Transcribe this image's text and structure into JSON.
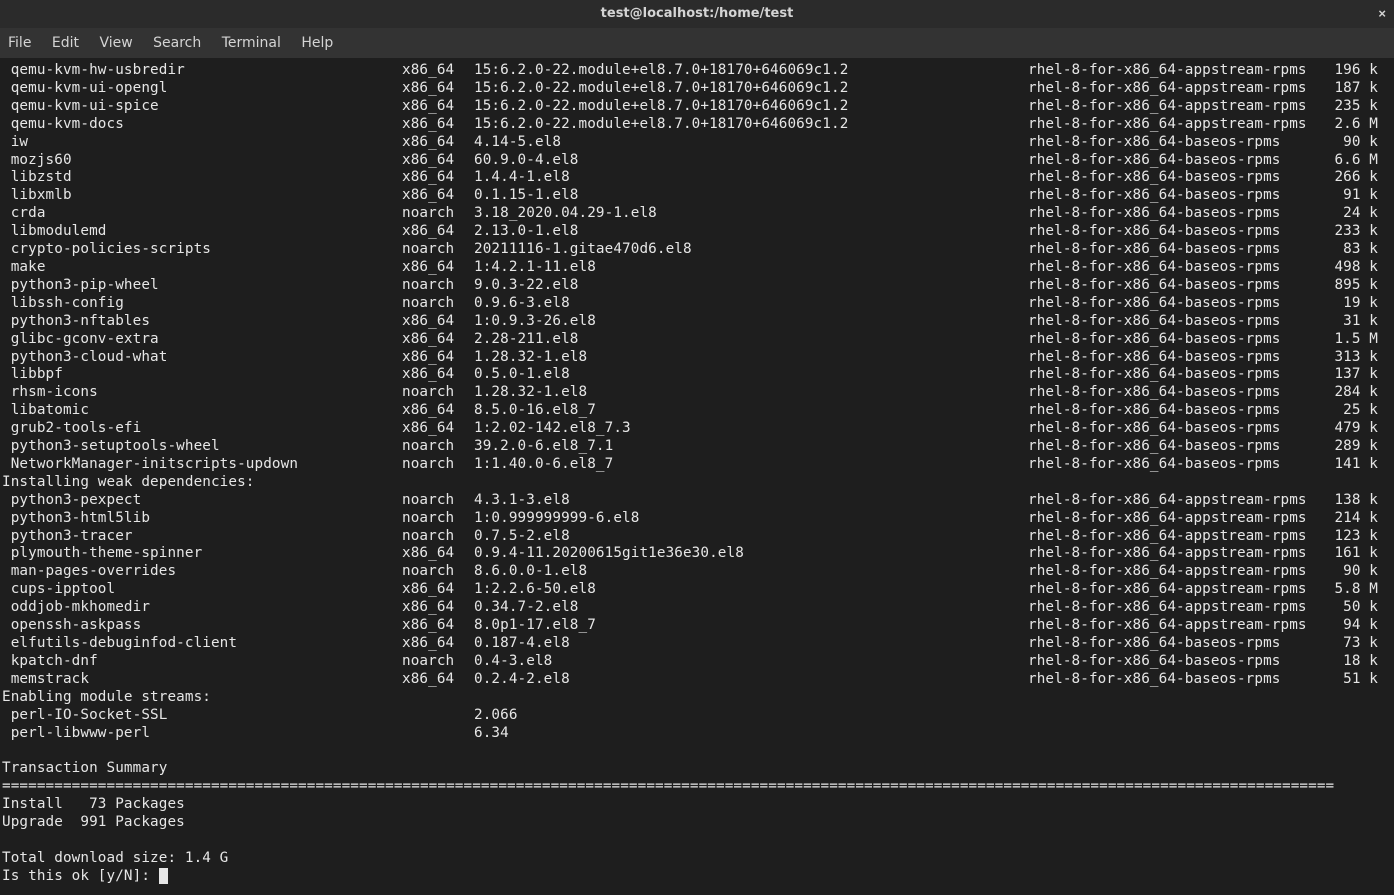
{
  "window": {
    "title": "test@localhost:/home/test"
  },
  "menu": {
    "file": "File",
    "edit": "Edit",
    "view": "View",
    "search": "Search",
    "terminal": "Terminal",
    "help": "Help"
  },
  "packages": [
    {
      "name": " qemu-kvm-hw-usbredir",
      "arch": "x86_64",
      "ver": "15:6.2.0-22.module+el8.7.0+18170+646069c1.2",
      "repo": "rhel-8-for-x86_64-appstream-rpms",
      "size": "196 k"
    },
    {
      "name": " qemu-kvm-ui-opengl",
      "arch": "x86_64",
      "ver": "15:6.2.0-22.module+el8.7.0+18170+646069c1.2",
      "repo": "rhel-8-for-x86_64-appstream-rpms",
      "size": "187 k"
    },
    {
      "name": " qemu-kvm-ui-spice",
      "arch": "x86_64",
      "ver": "15:6.2.0-22.module+el8.7.0+18170+646069c1.2",
      "repo": "rhel-8-for-x86_64-appstream-rpms",
      "size": "235 k"
    },
    {
      "name": " qemu-kvm-docs",
      "arch": "x86_64",
      "ver": "15:6.2.0-22.module+el8.7.0+18170+646069c1.2",
      "repo": "rhel-8-for-x86_64-appstream-rpms",
      "size": "2.6 M"
    },
    {
      "name": " iw",
      "arch": "x86_64",
      "ver": "4.14-5.el8",
      "repo": "rhel-8-for-x86_64-baseos-rpms",
      "size": "90 k"
    },
    {
      "name": " mozjs60",
      "arch": "x86_64",
      "ver": "60.9.0-4.el8",
      "repo": "rhel-8-for-x86_64-baseos-rpms",
      "size": "6.6 M"
    },
    {
      "name": " libzstd",
      "arch": "x86_64",
      "ver": "1.4.4-1.el8",
      "repo": "rhel-8-for-x86_64-baseos-rpms",
      "size": "266 k"
    },
    {
      "name": " libxmlb",
      "arch": "x86_64",
      "ver": "0.1.15-1.el8",
      "repo": "rhel-8-for-x86_64-baseos-rpms",
      "size": "91 k"
    },
    {
      "name": " crda",
      "arch": "noarch",
      "ver": "3.18_2020.04.29-1.el8",
      "repo": "rhel-8-for-x86_64-baseos-rpms",
      "size": "24 k"
    },
    {
      "name": " libmodulemd",
      "arch": "x86_64",
      "ver": "2.13.0-1.el8",
      "repo": "rhel-8-for-x86_64-baseos-rpms",
      "size": "233 k"
    },
    {
      "name": " crypto-policies-scripts",
      "arch": "noarch",
      "ver": "20211116-1.gitae470d6.el8",
      "repo": "rhel-8-for-x86_64-baseos-rpms",
      "size": "83 k"
    },
    {
      "name": " make",
      "arch": "x86_64",
      "ver": "1:4.2.1-11.el8",
      "repo": "rhel-8-for-x86_64-baseos-rpms",
      "size": "498 k"
    },
    {
      "name": " python3-pip-wheel",
      "arch": "noarch",
      "ver": "9.0.3-22.el8",
      "repo": "rhel-8-for-x86_64-baseos-rpms",
      "size": "895 k"
    },
    {
      "name": " libssh-config",
      "arch": "noarch",
      "ver": "0.9.6-3.el8",
      "repo": "rhel-8-for-x86_64-baseos-rpms",
      "size": "19 k"
    },
    {
      "name": " python3-nftables",
      "arch": "x86_64",
      "ver": "1:0.9.3-26.el8",
      "repo": "rhel-8-for-x86_64-baseos-rpms",
      "size": "31 k"
    },
    {
      "name": " glibc-gconv-extra",
      "arch": "x86_64",
      "ver": "2.28-211.el8",
      "repo": "rhel-8-for-x86_64-baseos-rpms",
      "size": "1.5 M"
    },
    {
      "name": " python3-cloud-what",
      "arch": "x86_64",
      "ver": "1.28.32-1.el8",
      "repo": "rhel-8-for-x86_64-baseos-rpms",
      "size": "313 k"
    },
    {
      "name": " libbpf",
      "arch": "x86_64",
      "ver": "0.5.0-1.el8",
      "repo": "rhel-8-for-x86_64-baseos-rpms",
      "size": "137 k"
    },
    {
      "name": " rhsm-icons",
      "arch": "noarch",
      "ver": "1.28.32-1.el8",
      "repo": "rhel-8-for-x86_64-baseos-rpms",
      "size": "284 k"
    },
    {
      "name": " libatomic",
      "arch": "x86_64",
      "ver": "8.5.0-16.el8_7",
      "repo": "rhel-8-for-x86_64-baseos-rpms",
      "size": "25 k"
    },
    {
      "name": " grub2-tools-efi",
      "arch": "x86_64",
      "ver": "1:2.02-142.el8_7.3",
      "repo": "rhel-8-for-x86_64-baseos-rpms",
      "size": "479 k"
    },
    {
      "name": " python3-setuptools-wheel",
      "arch": "noarch",
      "ver": "39.2.0-6.el8_7.1",
      "repo": "rhel-8-for-x86_64-baseos-rpms",
      "size": "289 k"
    },
    {
      "name": " NetworkManager-initscripts-updown",
      "arch": "noarch",
      "ver": "1:1.40.0-6.el8_7",
      "repo": "rhel-8-for-x86_64-baseos-rpms",
      "size": "141 k"
    }
  ],
  "section_weak": "Installing weak dependencies:",
  "weak_packages": [
    {
      "name": " python3-pexpect",
      "arch": "noarch",
      "ver": "4.3.1-3.el8",
      "repo": "rhel-8-for-x86_64-appstream-rpms",
      "size": "138 k"
    },
    {
      "name": " python3-html5lib",
      "arch": "noarch",
      "ver": "1:0.999999999-6.el8",
      "repo": "rhel-8-for-x86_64-appstream-rpms",
      "size": "214 k"
    },
    {
      "name": " python3-tracer",
      "arch": "noarch",
      "ver": "0.7.5-2.el8",
      "repo": "rhel-8-for-x86_64-appstream-rpms",
      "size": "123 k"
    },
    {
      "name": " plymouth-theme-spinner",
      "arch": "x86_64",
      "ver": "0.9.4-11.20200615git1e36e30.el8",
      "repo": "rhel-8-for-x86_64-appstream-rpms",
      "size": "161 k"
    },
    {
      "name": " man-pages-overrides",
      "arch": "noarch",
      "ver": "8.6.0.0-1.el8",
      "repo": "rhel-8-for-x86_64-appstream-rpms",
      "size": "90 k"
    },
    {
      "name": " cups-ipptool",
      "arch": "x86_64",
      "ver": "1:2.2.6-50.el8",
      "repo": "rhel-8-for-x86_64-appstream-rpms",
      "size": "5.8 M"
    },
    {
      "name": " oddjob-mkhomedir",
      "arch": "x86_64",
      "ver": "0.34.7-2.el8",
      "repo": "rhel-8-for-x86_64-appstream-rpms",
      "size": "50 k"
    },
    {
      "name": " openssh-askpass",
      "arch": "x86_64",
      "ver": "8.0p1-17.el8_7",
      "repo": "rhel-8-for-x86_64-appstream-rpms",
      "size": "94 k"
    },
    {
      "name": " elfutils-debuginfod-client",
      "arch": "x86_64",
      "ver": "0.187-4.el8",
      "repo": "rhel-8-for-x86_64-baseos-rpms",
      "size": "73 k"
    },
    {
      "name": " kpatch-dnf",
      "arch": "noarch",
      "ver": "0.4-3.el8",
      "repo": "rhel-8-for-x86_64-baseos-rpms",
      "size": "18 k"
    },
    {
      "name": " memstrack",
      "arch": "x86_64",
      "ver": "0.2.4-2.el8",
      "repo": "rhel-8-for-x86_64-baseos-rpms",
      "size": "51 k"
    }
  ],
  "section_modules": "Enabling module streams:",
  "modules": [
    {
      "name": " perl-IO-Socket-SSL",
      "ver": "2.066"
    },
    {
      "name": " perl-libwww-perl",
      "ver": "6.34"
    }
  ],
  "summary": {
    "heading": "Transaction Summary",
    "rule": "=========================================================================================================================================================",
    "install": "Install   73 Packages",
    "upgrade": "Upgrade  991 Packages",
    "download": "Total download size: 1.4 G",
    "prompt": "Is this ok [y/N]: "
  }
}
